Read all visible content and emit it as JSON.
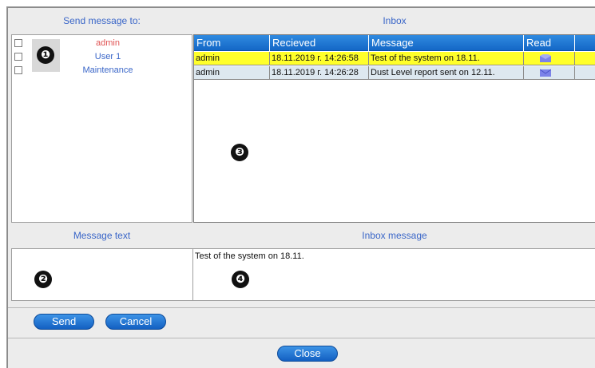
{
  "recipients_panel": {
    "header": "Send message to:",
    "items": [
      {
        "label": "admin",
        "color": "#e05454",
        "checked": false
      },
      {
        "label": "User 1",
        "color": "#3a66c8",
        "checked": false
      },
      {
        "label": "Maintenance",
        "color": "#3a66c8",
        "checked": false
      }
    ]
  },
  "inbox_panel": {
    "header": "Inbox",
    "columns": [
      "From",
      "Recieved",
      "Message",
      "Read"
    ],
    "rows": [
      {
        "from": "admin",
        "received": "18.11.2019 г. 14:26:58",
        "message": "Test of the system on 18.11.",
        "read_icon": "envelope-open-icon",
        "selected": true
      },
      {
        "from": "admin",
        "received": "18.11.2019 г. 14:26:28",
        "message": "Dust Level report sent on 12.11.",
        "read_icon": "envelope-closed-icon",
        "selected": false
      }
    ]
  },
  "message_text": {
    "header": "Message text",
    "value": ""
  },
  "inbox_message": {
    "header": "Inbox message",
    "value": "Test of the system on 18.11."
  },
  "buttons": {
    "send": "Send",
    "cancel": "Cancel",
    "close": "Close"
  },
  "callouts": {
    "one": "❶",
    "two": "❷",
    "three": "❸",
    "four": "❹"
  },
  "colors": {
    "header_text": "#3a66c8",
    "grid_header": "#1f78d8",
    "selected_row": "#ffff2a",
    "normal_row": "#dde8f0",
    "button": "#1f74d4"
  }
}
